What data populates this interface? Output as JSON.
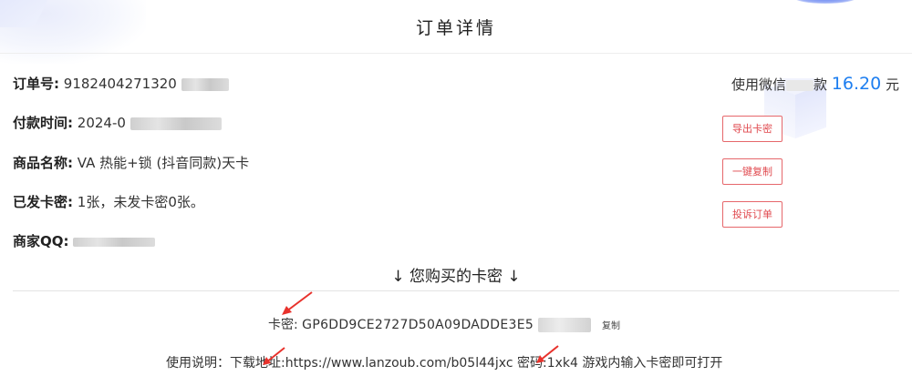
{
  "header": {
    "title": "订单详情"
  },
  "order": {
    "number_label": "订单号:",
    "number_value": "9182404271320",
    "time_label": "付款时间:",
    "time_value": "2024-0",
    "product_label": "商品名称:",
    "product_value": "VA 热能+锁 (抖音同款)天卡",
    "issued_label": "已发卡密:",
    "issued_value": "1张，未发卡密0张。",
    "merchant_label": "商家QQ:"
  },
  "payment": {
    "prefix": "使用微信",
    "suffix": "款",
    "amount": "16.20",
    "currency": "元"
  },
  "actions": {
    "export_label": "导出卡密",
    "copy_all_label": "一键复制",
    "complain_label": "投诉订单"
  },
  "cards": {
    "section_title": "↓ 您购买的卡密 ↓",
    "card_label": "卡密:",
    "card_value": "GP6DD9CE2727D50A09DADDE3E5",
    "copy_label": "复制",
    "usage_text": "使用说明：下载地址:https://www.lanzoub.com/b05l44jxc 密码:1xk4 游戏内输入卡密即可打开"
  },
  "colors": {
    "accent_blue": "#1d7ef0",
    "button_red": "#e04a4f",
    "annotation_arrow": "#e8322c"
  }
}
